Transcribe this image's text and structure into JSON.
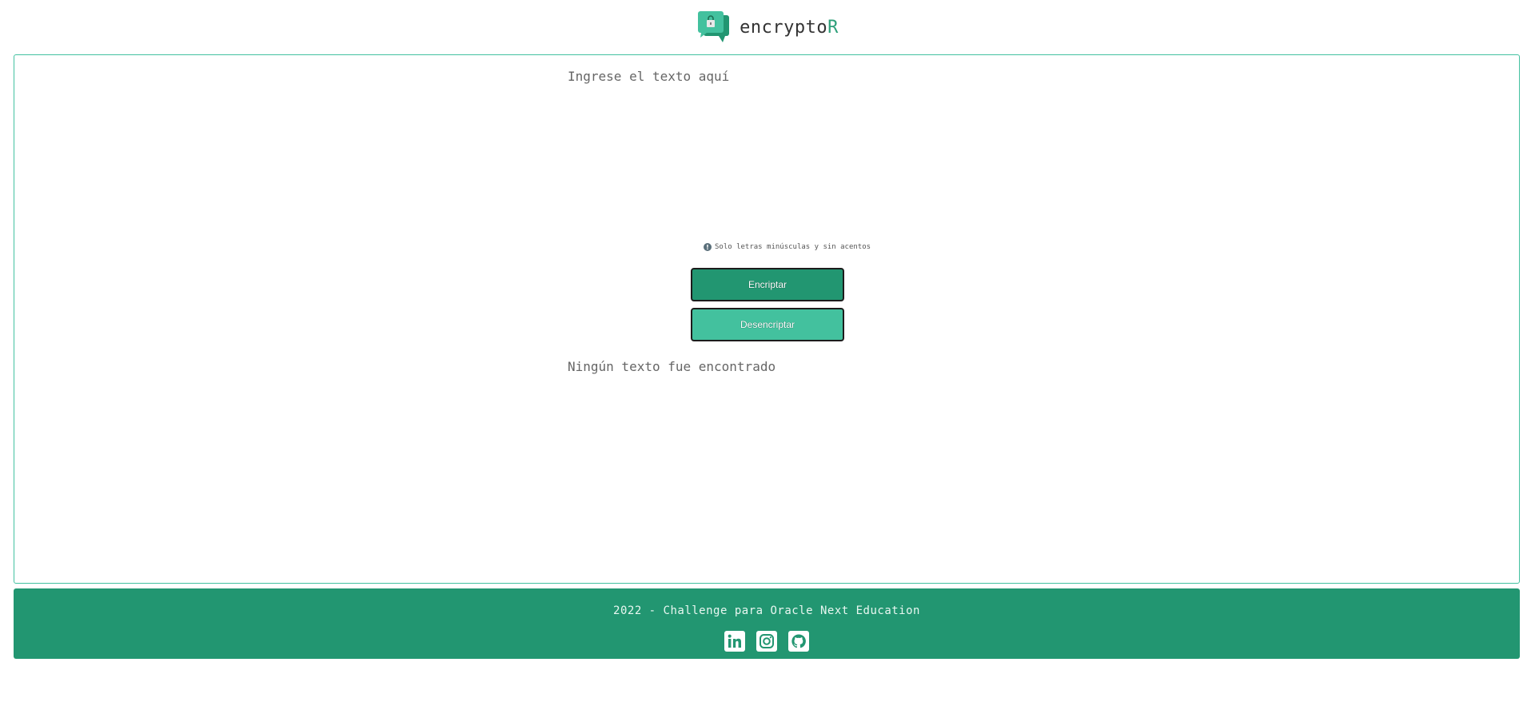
{
  "header": {
    "brand_main": "encrypto",
    "brand_accent": "R",
    "logo_icon": "chat-lock-icon"
  },
  "main": {
    "input_placeholder": "Ingrese el texto aquí",
    "hint": "Solo letras minúsculas y sin acentos",
    "hint_icon": "info-icon",
    "encrypt_label": "Encriptar",
    "decrypt_label": "Desencriptar",
    "output_empty": "Ningún texto fue encontrado"
  },
  "footer": {
    "text": "2022 - Challenge para Oracle Next Education",
    "social": [
      "linkedin-icon",
      "instagram-icon",
      "github-icon"
    ]
  },
  "colors": {
    "primary": "#229671",
    "secondary": "#43c19e",
    "border": "#43c1a0"
  }
}
